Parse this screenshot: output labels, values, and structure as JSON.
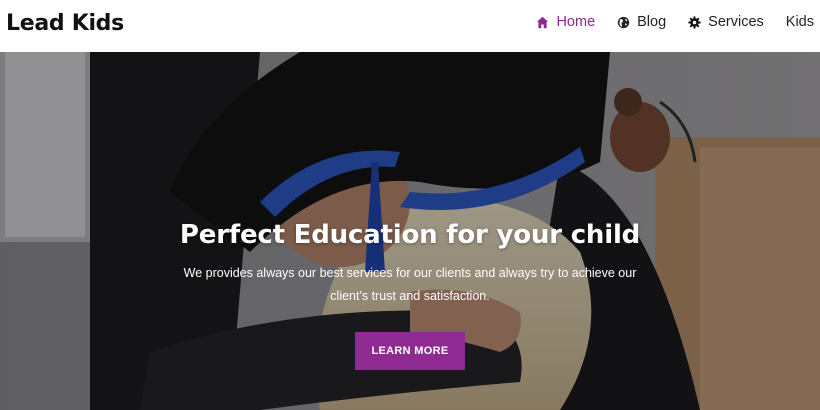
{
  "site": {
    "logo": "Lead Kids"
  },
  "nav": {
    "items": [
      {
        "label": "Home",
        "icon": "home-icon",
        "active": true
      },
      {
        "label": "Blog",
        "icon": "globe-icon"
      },
      {
        "label": "Services",
        "icon": "gear-icon"
      },
      {
        "label": "Kids",
        "icon": ""
      }
    ]
  },
  "hero": {
    "title": "Perfect Education for your child",
    "subtitle": "We provides always our best services for our clients and always try to achieve our client's trust and satisfaction.",
    "cta_label": "LEARN MORE"
  },
  "colors": {
    "accent": "#8f2a92",
    "nav_active": "#8a2a8c"
  }
}
